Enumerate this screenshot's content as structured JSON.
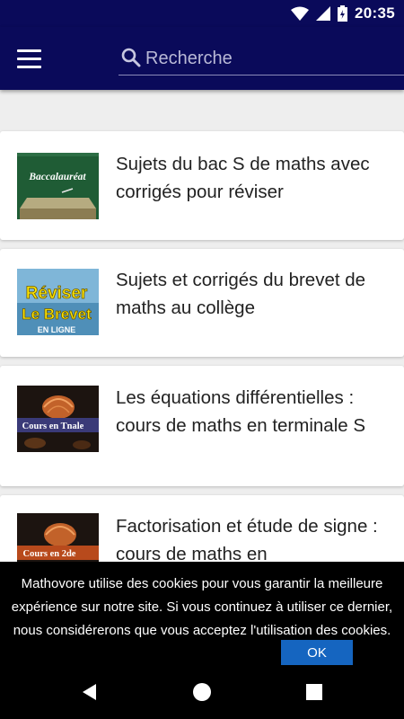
{
  "status_bar": {
    "time": "20:35",
    "icons": [
      "wifi-icon",
      "signal-icon",
      "battery-icon"
    ]
  },
  "app_bar": {
    "menu_icon": "hamburger-menu-icon",
    "search_icon": "search-icon",
    "search_placeholder": "Recherche"
  },
  "articles": [
    {
      "title": "Sujets du bac S de maths avec corrigés pour réviser",
      "thumb_label": "Baccalauréat"
    },
    {
      "title": "Sujets et corrigés du brevet de maths au collège",
      "thumb_label_line1": "Réviser",
      "thumb_label_line2": "Le Brevet",
      "thumb_label_line3": "EN LIGNE"
    },
    {
      "title": "Les équations différentielles : cours de maths en terminale S",
      "thumb_label": "Cours en Tnale"
    },
    {
      "title": "Factorisation et étude de signe : cours de maths en",
      "thumb_label": "Cours en 2de"
    }
  ],
  "cookie_banner": {
    "text": "Mathovore utilise des cookies pour vous garantir la meilleure expérience sur notre site. Si vous continuez à utiliser ce dernier, nous considérerons que vous acceptez l'utilisation des cookies.",
    "ok_label": "OK"
  },
  "nav_bar": {
    "icons": [
      "back-icon",
      "home-icon",
      "recents-icon"
    ]
  },
  "colors": {
    "app_bar": "#0a0a5a",
    "ok_button": "#1565c0",
    "background": "#eeeeee"
  }
}
